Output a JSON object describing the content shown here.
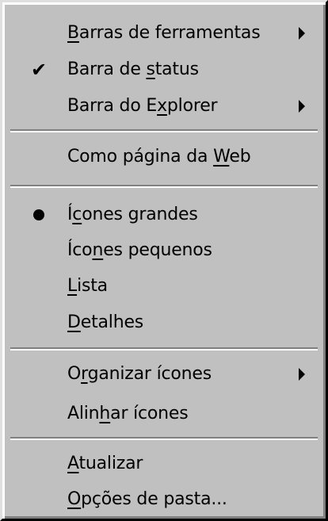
{
  "menu": {
    "items": [
      {
        "pre": "",
        "u": "B",
        "post": "arras de ferramentas",
        "submenu": true
      },
      {
        "pre": "Barra de ",
        "u": "s",
        "post": "tatus",
        "check": "✔"
      },
      {
        "pre": "Barra do E",
        "u": "x",
        "post": "plorer",
        "submenu": true
      },
      {
        "pre": "Como página da ",
        "u": "W",
        "post": "eb"
      },
      {
        "pre": "Í",
        "u": "c",
        "post": "ones grandes",
        "selected": true
      },
      {
        "pre": "Íco",
        "u": "n",
        "post": "es pequenos"
      },
      {
        "pre": "",
        "u": "L",
        "post": "ista"
      },
      {
        "pre": "",
        "u": "D",
        "post": "etalhes"
      },
      {
        "pre": "O",
        "u": "r",
        "post": "ganizar ícones",
        "submenu": true
      },
      {
        "pre": "Alin",
        "u": "h",
        "post": "ar ícones"
      },
      {
        "pre": "",
        "u": "A",
        "post": "tualizar"
      },
      {
        "pre": "",
        "u": "O",
        "post": "pções de pasta..."
      }
    ]
  }
}
